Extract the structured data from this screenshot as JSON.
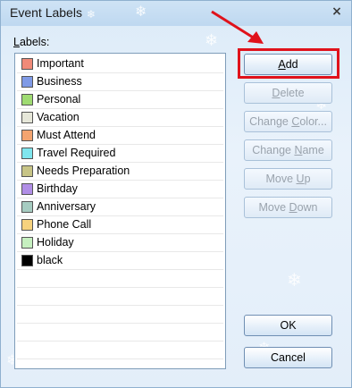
{
  "window": {
    "title": "Event Labels",
    "close_glyph": "×"
  },
  "labels_caption": {
    "accel": "L",
    "rest": "abels:"
  },
  "labels": [
    {
      "name": "Important",
      "color": "#f08a78"
    },
    {
      "name": "Business",
      "color": "#7f9ae6"
    },
    {
      "name": "Personal",
      "color": "#9fdb72"
    },
    {
      "name": "Vacation",
      "color": "#e6e7d9"
    },
    {
      "name": "Must Attend",
      "color": "#f3a470"
    },
    {
      "name": "Travel Required",
      "color": "#7fe6ee"
    },
    {
      "name": "Needs Preparation",
      "color": "#c7c486"
    },
    {
      "name": "Birthday",
      "color": "#b08ee6"
    },
    {
      "name": "Anniversary",
      "color": "#a6ccc1"
    },
    {
      "name": "Phone Call",
      "color": "#f6d27e"
    },
    {
      "name": "Holiday",
      "color": "#c6f0c0"
    },
    {
      "name": "black",
      "color": "#000000"
    }
  ],
  "buttons": {
    "add": {
      "pre": "",
      "acc": "A",
      "post": "dd",
      "enabled": true
    },
    "delete": {
      "pre": "",
      "acc": "D",
      "post": "elete",
      "enabled": false
    },
    "change_color": {
      "pre": "Change ",
      "acc": "C",
      "post": "olor...",
      "enabled": false
    },
    "change_name": {
      "pre": "Change ",
      "acc": "N",
      "post": "ame",
      "enabled": false
    },
    "move_up": {
      "pre": "Move ",
      "acc": "U",
      "post": "p",
      "enabled": false
    },
    "move_down": {
      "pre": "Move ",
      "acc": "D",
      "post": "own",
      "enabled": false
    },
    "ok": {
      "pre": "",
      "acc": "",
      "post": "OK",
      "enabled": true
    },
    "cancel": {
      "pre": "",
      "acc": "",
      "post": "Cancel",
      "enabled": true
    }
  },
  "colors": {
    "highlight": "#e0121b",
    "arrow": "#e0121b"
  }
}
